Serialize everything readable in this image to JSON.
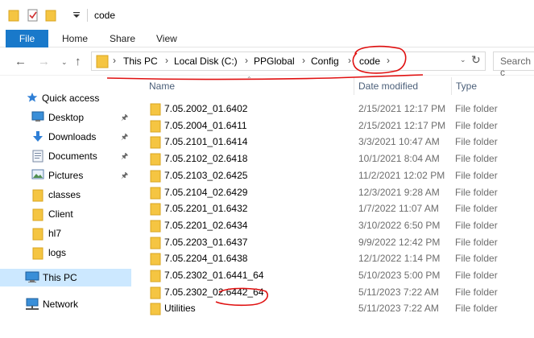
{
  "window": {
    "title": "code"
  },
  "ribbon": {
    "tabs": [
      "File",
      "Home",
      "Share",
      "View"
    ]
  },
  "address": {
    "crumbs": [
      "This PC",
      "Local Disk (C:)",
      "PPGlobal",
      "Config",
      "code"
    ],
    "search_placeholder": "Search c"
  },
  "columns": {
    "name": "Name",
    "date": "Date modified",
    "type": "Type"
  },
  "sidebar": {
    "items": [
      {
        "label": "Quick access",
        "icon": "star-icon",
        "pinned": false
      },
      {
        "label": "Desktop",
        "icon": "desktop-icon",
        "pinned": true
      },
      {
        "label": "Downloads",
        "icon": "download-icon",
        "pinned": true
      },
      {
        "label": "Documents",
        "icon": "documents-icon",
        "pinned": true
      },
      {
        "label": "Pictures",
        "icon": "pictures-icon",
        "pinned": true
      },
      {
        "label": "classes",
        "icon": "folder-icon",
        "pinned": false
      },
      {
        "label": "Client",
        "icon": "folder-icon",
        "pinned": false
      },
      {
        "label": "hl7",
        "icon": "folder-icon",
        "pinned": false
      },
      {
        "label": "logs",
        "icon": "folder-icon",
        "pinned": false
      },
      {
        "label": "This PC",
        "icon": "computer-icon",
        "pinned": false
      },
      {
        "label": "Network",
        "icon": "network-icon",
        "pinned": false
      }
    ]
  },
  "files": [
    {
      "name": "7.05.2002_01.6402",
      "date": "2/15/2021 12:17 PM",
      "type": "File folder"
    },
    {
      "name": "7.05.2004_01.6411",
      "date": "2/15/2021 12:17 PM",
      "type": "File folder"
    },
    {
      "name": "7.05.2101_01.6414",
      "date": "3/3/2021 10:47 AM",
      "type": "File folder"
    },
    {
      "name": "7.05.2102_02.6418",
      "date": "10/1/2021 8:04 AM",
      "type": "File folder"
    },
    {
      "name": "7.05.2103_02.6425",
      "date": "11/2/2021 12:02 PM",
      "type": "File folder"
    },
    {
      "name": "7.05.2104_02.6429",
      "date": "12/3/2021 9:28 AM",
      "type": "File folder"
    },
    {
      "name": "7.05.2201_01.6432",
      "date": "1/7/2022 11:07 AM",
      "type": "File folder"
    },
    {
      "name": "7.05.2201_02.6434",
      "date": "3/10/2022 6:50 PM",
      "type": "File folder"
    },
    {
      "name": "7.05.2203_01.6437",
      "date": "9/9/2022 12:42 PM",
      "type": "File folder"
    },
    {
      "name": "7.05.2204_01.6438",
      "date": "12/1/2022 1:14 PM",
      "type": "File folder"
    },
    {
      "name": "7.05.2302_01.6441_64",
      "date": "5/10/2023 5:00 PM",
      "type": "File folder"
    },
    {
      "name": "7.05.2302_02.6442_64",
      "date": "5/11/2023 7:22 AM",
      "type": "File folder"
    },
    {
      "name": "Utilities",
      "date": "5/11/2023 7:22 AM",
      "type": "File folder"
    }
  ],
  "colors": {
    "file_tab": "#1979ca",
    "folder": "#f5c542",
    "selection": "#cce8ff",
    "annotation": "#e01010",
    "header_text": "#4c607a"
  }
}
